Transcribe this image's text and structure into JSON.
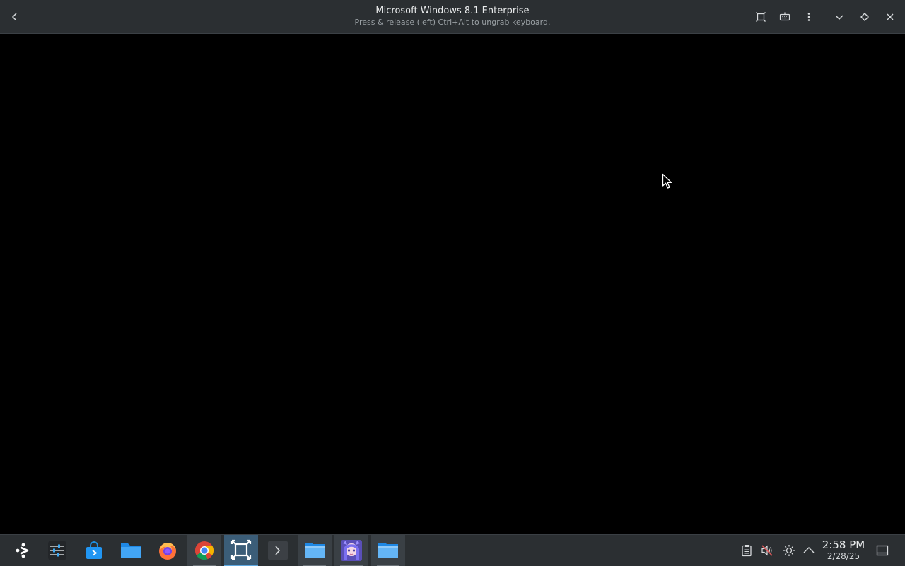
{
  "window": {
    "title": "Microsoft Windows 8.1 Enterprise",
    "subtitle": "Press & release (left) Ctrl+Alt to ungrab keyboard."
  },
  "header_icons": {
    "back": "back-arrow-icon",
    "fullscreen": "fullscreen-icon",
    "keyboard": "keyboard-icon",
    "menu": "kebab-menu-icon",
    "minimize": "chevron-down-icon",
    "maximize": "diamond-icon",
    "close": "close-icon"
  },
  "taskbar": {
    "apps": [
      {
        "name": "application-launcher",
        "icon": "launcher-icon"
      },
      {
        "name": "system-settings",
        "icon": "settings-sliders-icon"
      },
      {
        "name": "discover-store",
        "icon": "store-bag-icon"
      },
      {
        "name": "file-manager",
        "icon": "folder-icon"
      },
      {
        "name": "firefox",
        "icon": "firefox-icon"
      },
      {
        "name": "chrome",
        "icon": "chrome-icon"
      },
      {
        "name": "virt-manager",
        "icon": "vm-frame-icon"
      },
      {
        "name": "terminal",
        "icon": "terminal-chevron-icon"
      },
      {
        "name": "file-manager-window",
        "icon": "folder-window-icon"
      },
      {
        "name": "anime-avatar-app",
        "icon": "avatar-icon"
      },
      {
        "name": "file-manager-window-2",
        "icon": "folder-window-icon"
      }
    ],
    "tray": {
      "clipboard": "clipboard-icon",
      "volume": "volume-muted-icon",
      "brightness": "brightness-icon",
      "expand": "chevron-up-icon",
      "desktop": "show-desktop-icon"
    },
    "clock": {
      "time": "2:58 PM",
      "date": "2/28/25"
    }
  },
  "colors": {
    "bar_bg": "#2b2f32",
    "active_task": "#3b5d78",
    "accent": "#5fa9e2",
    "display_bg": "#000000"
  }
}
